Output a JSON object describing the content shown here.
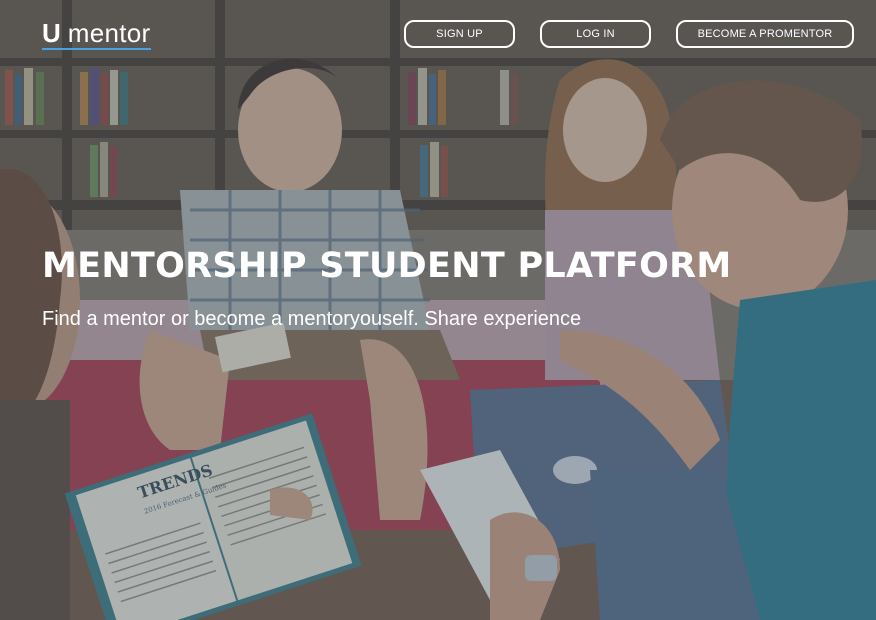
{
  "header": {
    "logo": {
      "mark": "U",
      "word": "mentor"
    },
    "nav": {
      "signup_label": "SIGN UP",
      "login_label": "LOG IN",
      "promentor_label": "BECOME A PROMENTOR"
    }
  },
  "hero": {
    "title": "MENTORSHIP STUDENT PLATFORM",
    "subtitle": "Find a mentor or become a mentoryouself. Share experience",
    "book": {
      "title": "TRENDS",
      "subtitle": "2016 Forecast & Guides"
    }
  },
  "colors": {
    "overlay": "#3c5264",
    "logo_underline": "#4aa3df",
    "text": "#ffffff"
  }
}
